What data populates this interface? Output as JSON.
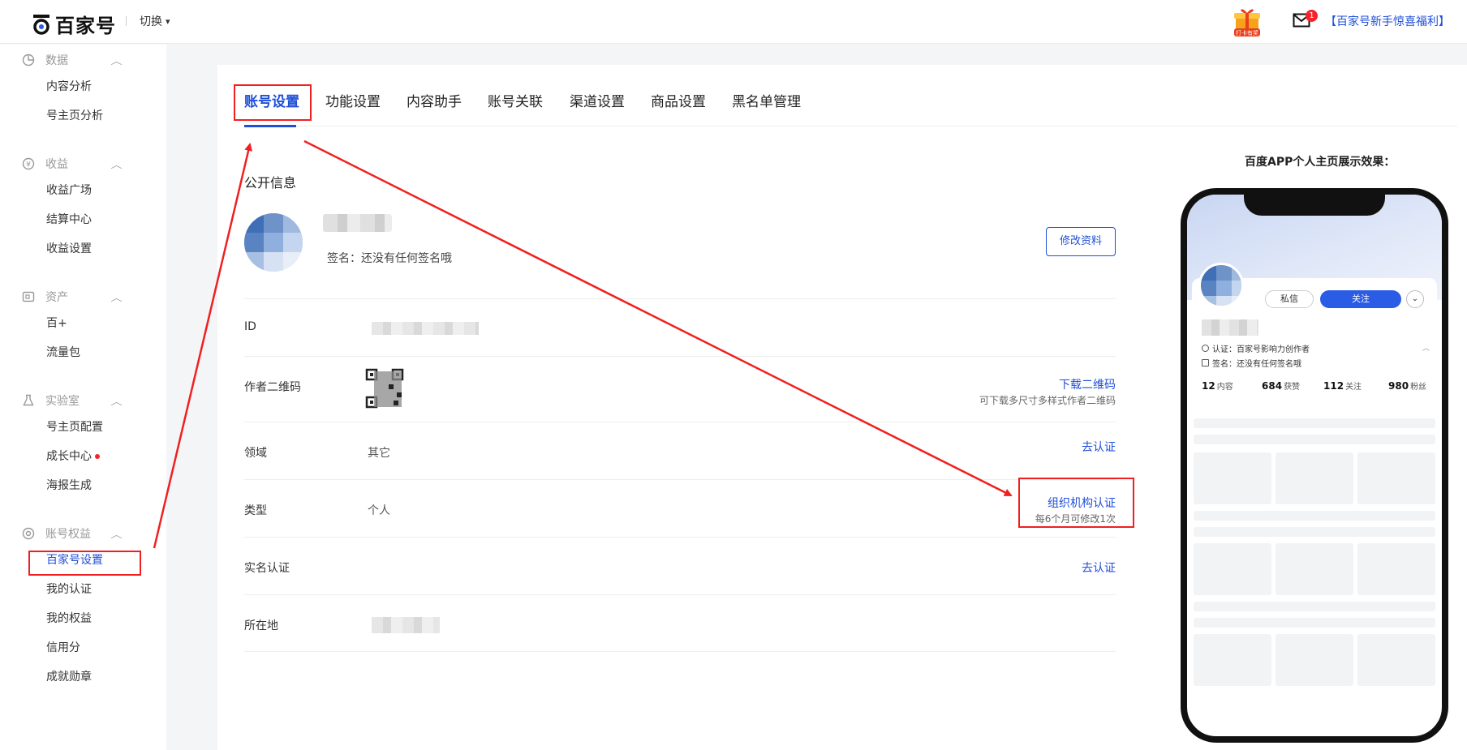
{
  "header": {
    "logo_text": "百家号",
    "switch_label": "切换",
    "gift_label": "打卡有奖",
    "mail_badge": "1",
    "promo_link": "【百家号新手惊喜福利】"
  },
  "sidebar": {
    "groups": [
      {
        "title": "数据",
        "items": [
          "内容分析",
          "号主页分析"
        ]
      },
      {
        "title": "收益",
        "items": [
          "收益广场",
          "结算中心",
          "收益设置"
        ]
      },
      {
        "title": "资产",
        "items": [
          "百+",
          "流量包"
        ]
      },
      {
        "title": "实验室",
        "items": [
          "号主页配置",
          "成长中心",
          "海报生成"
        ]
      },
      {
        "title": "账号权益",
        "items": [
          "百家号设置",
          "我的认证",
          "我的权益",
          "信用分",
          "成就勋章"
        ]
      }
    ],
    "active_item": "百家号设置"
  },
  "tabs": [
    "账号设置",
    "功能设置",
    "内容助手",
    "账号关联",
    "渠道设置",
    "商品设置",
    "黑名单管理"
  ],
  "active_tab": "账号设置",
  "profile": {
    "section_title": "公开信息",
    "signature": "签名：还没有任何签名哦",
    "edit_button": "修改资料"
  },
  "rows": {
    "id": {
      "label": "ID"
    },
    "qrcode": {
      "label": "作者二维码",
      "link": "下载二维码",
      "sub": "可下载多尺寸多样式作者二维码"
    },
    "domain": {
      "label": "领域",
      "value": "其它",
      "link": "去认证"
    },
    "type": {
      "label": "类型",
      "value": "个人",
      "link": "组织机构认证",
      "sub": "每6个月可修改1次"
    },
    "realname": {
      "label": "实名认证",
      "link": "去认证"
    },
    "location": {
      "label": "所在地"
    }
  },
  "preview": {
    "title": "百度APP个人主页展示效果：",
    "msg_button": "私信",
    "follow_button": "关注",
    "cert_line": "认证：百家号影响力创作者",
    "sign_line": "签名：还没有任何签名哦",
    "stats": [
      {
        "num": "12",
        "label": "内容"
      },
      {
        "num": "684",
        "label": "获赞"
      },
      {
        "num": "112",
        "label": "关注"
      },
      {
        "num": "980",
        "label": "粉丝"
      }
    ]
  },
  "colors": {
    "accent": "#1f4fd8",
    "annotation": "#f02020",
    "badge": "#f5222d"
  }
}
